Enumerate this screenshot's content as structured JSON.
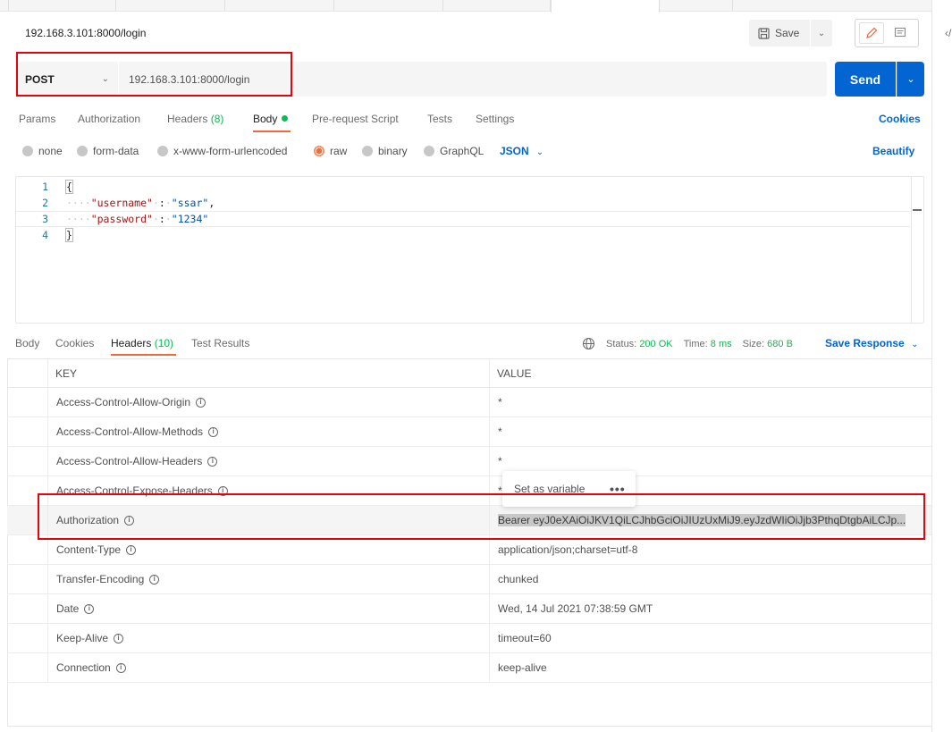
{
  "request": {
    "title": "192.168.3.101:8000/login",
    "method": "POST",
    "url": "192.168.3.101:8000/login",
    "save_label": "Save",
    "send_label": "Send"
  },
  "request_tabs": {
    "params": "Params",
    "authorization": "Authorization",
    "headers": "Headers",
    "headers_count": "(8)",
    "body": "Body",
    "prerequest": "Pre-request Script",
    "tests": "Tests",
    "settings": "Settings",
    "cookies": "Cookies"
  },
  "body_options": {
    "none": "none",
    "form_data": "form-data",
    "urlencoded": "x-www-form-urlencoded",
    "raw": "raw",
    "binary": "binary",
    "graphql": "GraphQL",
    "selected": "raw",
    "language": "JSON",
    "beautify": "Beautify"
  },
  "editor": {
    "lines": [
      {
        "num": "1",
        "text": "{"
      },
      {
        "num": "2",
        "key": "\"username\"",
        "value": "\"ssar\"",
        "trail": ","
      },
      {
        "num": "3",
        "key": "\"password\"",
        "value": "\"1234\"",
        "trail": ""
      },
      {
        "num": "4",
        "text": "}"
      }
    ]
  },
  "response_tabs": {
    "body": "Body",
    "cookies": "Cookies",
    "headers": "Headers",
    "headers_count": "(10)",
    "test_results": "Test Results",
    "status_label": "Status:",
    "status_value": "200 OK",
    "time_label": "Time:",
    "time_value": "8 ms",
    "size_label": "Size:",
    "size_value": "680 B",
    "save_response": "Save Response"
  },
  "headers_table": {
    "key_header": "KEY",
    "value_header": "VALUE",
    "rows": [
      {
        "key": "Access-Control-Allow-Origin",
        "value": "*"
      },
      {
        "key": "Access-Control-Allow-Methods",
        "value": "*"
      },
      {
        "key": "Access-Control-Allow-Headers",
        "value": "*"
      },
      {
        "key": "Access-Control-Expose-Headers",
        "value": "*"
      },
      {
        "key": "Authorization",
        "value": "Bearer eyJ0eXAiOiJKV1QiLCJhbGciOiJIUzUxMiJ9.eyJzdWIiOiJjb3PthqDtgbAiLCJp..."
      },
      {
        "key": "Content-Type",
        "value": "application/json;charset=utf-8"
      },
      {
        "key": "Transfer-Encoding",
        "value": "chunked"
      },
      {
        "key": "Date",
        "value": "Wed, 14 Jul 2021 07:38:59 GMT"
      },
      {
        "key": "Keep-Alive",
        "value": "timeout=60"
      },
      {
        "key": "Connection",
        "value": "keep-alive"
      }
    ]
  },
  "popover": {
    "set_as_variable": "Set as variable",
    "more": "•••"
  },
  "icons": {
    "save": "save-icon",
    "edit": "pencil-icon",
    "comment": "comment-icon",
    "globe": "globe-icon",
    "info": "info-icon",
    "code": "code-icon"
  },
  "colors": {
    "accent_orange": "#f26b3a",
    "send_blue": "#0265d2",
    "status_green": "#0cbb52",
    "annotation_red": "#e3050d"
  }
}
